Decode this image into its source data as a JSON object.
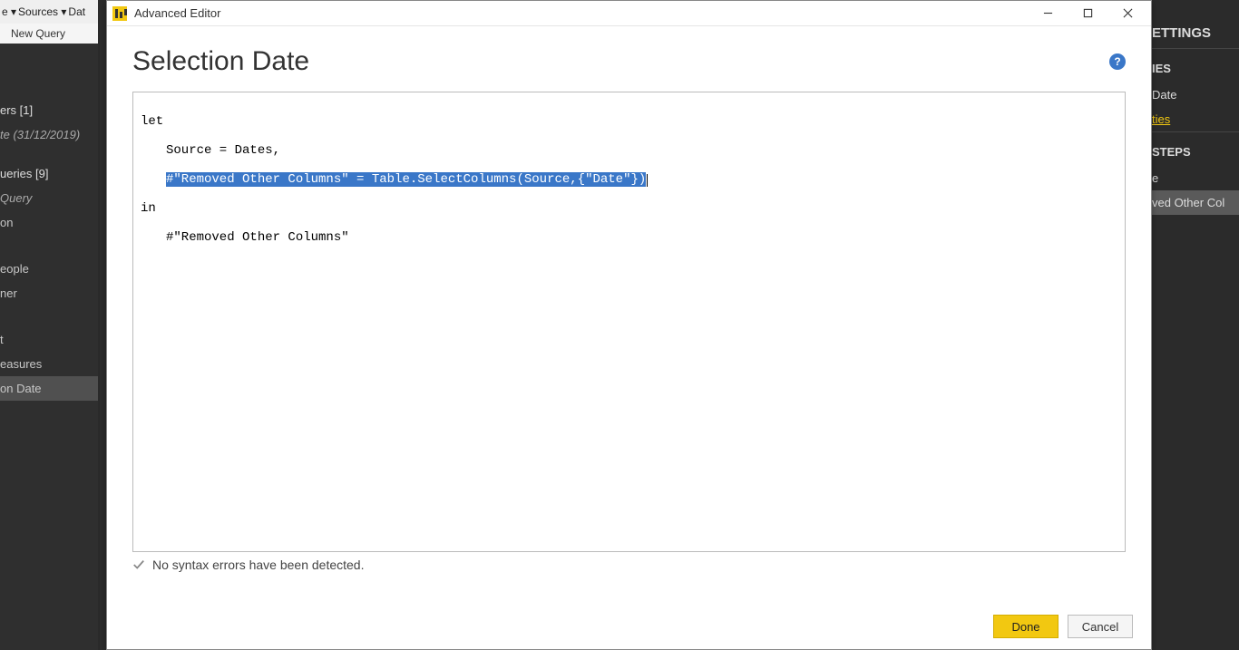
{
  "bg": {
    "menu_items": [
      "e ▾",
      "Sources ▾",
      "Dat"
    ],
    "new_query": "New Query",
    "left_header1": "ers [1]",
    "left_item1": "te (31/12/2019)",
    "left_header2": "ueries [9]",
    "left_item2": "Query",
    "left_item3": "on",
    "left_item4": "eople",
    "left_item5": "ner",
    "left_item6": "t",
    "left_item7": "easures",
    "left_item8_selected": "on Date",
    "right": {
      "settings": "ETTINGS",
      "section1": "IES",
      "name_value": "Date",
      "link": "ties",
      "section2": "STEPS",
      "step1": "e",
      "step2_selected": "ved Other Col"
    }
  },
  "dialog": {
    "title": "Advanced Editor",
    "heading": "Selection Date",
    "help_glyph": "?",
    "code": {
      "line1": "let",
      "line2": "Source = Dates,",
      "line3_selected": "#\"Removed Other Columns\" = Table.SelectColumns(Source,{\"Date\"})",
      "line4": "in",
      "line5": "#\"Removed Other Columns\""
    },
    "status": "No syntax errors have been detected.",
    "buttons": {
      "done": "Done",
      "cancel": "Cancel"
    },
    "winbtn": {
      "min": "minimize",
      "max": "maximize",
      "close": "close"
    }
  }
}
